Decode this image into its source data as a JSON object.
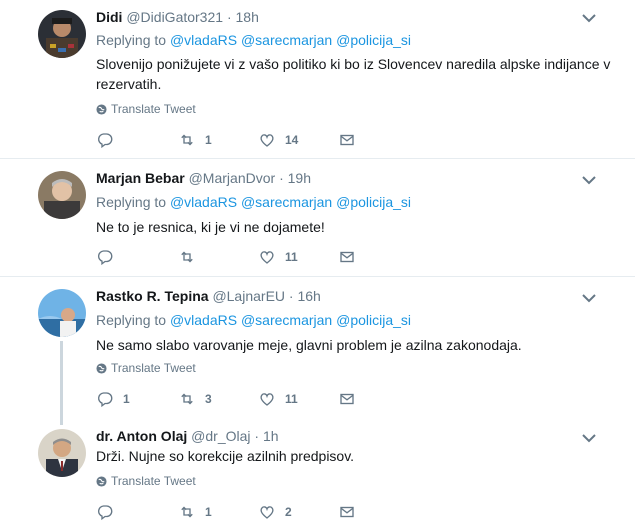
{
  "reply_label": "Replying to",
  "translate_label": "Translate Tweet",
  "tweets": [
    {
      "name": "Didi",
      "handle": "@DidiGator321",
      "time": "18h",
      "mentions": [
        "@vladaRS",
        "@sarecmarjan",
        "@policija_si"
      ],
      "text": "Slovenijo ponižujete vi z vašo politiko ki bo iz Slovencev naredila alpske indijance v rezervatih.",
      "show_translate": true,
      "replies": "",
      "retweets": "1",
      "likes": "14"
    },
    {
      "name": "Marjan Bebar",
      "handle": "@MarjanDvor",
      "time": "19h",
      "mentions": [
        "@vladaRS",
        "@sarecmarjan",
        "@policija_si"
      ],
      "text": "Ne to je resnica, ki je vi ne dojamete!",
      "show_translate": false,
      "replies": "",
      "retweets": "",
      "likes": "11"
    },
    {
      "name": "Rastko R. Tepina",
      "handle": "@LajnarEU",
      "time": "16h",
      "mentions": [
        "@vladaRS",
        "@sarecmarjan",
        "@policija_si"
      ],
      "text": "Ne samo slabo varovanje meje, glavni problem je azilna zakonodaja.",
      "show_translate": true,
      "replies": "1",
      "retweets": "3",
      "likes": "11"
    },
    {
      "name": "dr. Anton Olaj",
      "handle": "@dr_Olaj",
      "time": "1h",
      "mentions": [],
      "text": "Drži. Nujne so korekcije azilnih predpisov.",
      "show_translate": true,
      "replies": "",
      "retweets": "1",
      "likes": "2"
    }
  ],
  "icons": {
    "reply": "reply-icon",
    "retweet": "retweet-icon",
    "like": "heart-icon",
    "dm": "envelope-icon",
    "caret": "chevron-down-icon",
    "globe": "globe-icon"
  },
  "colors": {
    "link": "#1b95e0",
    "muted": "#657786",
    "thread_line": "#ccd6dd"
  }
}
